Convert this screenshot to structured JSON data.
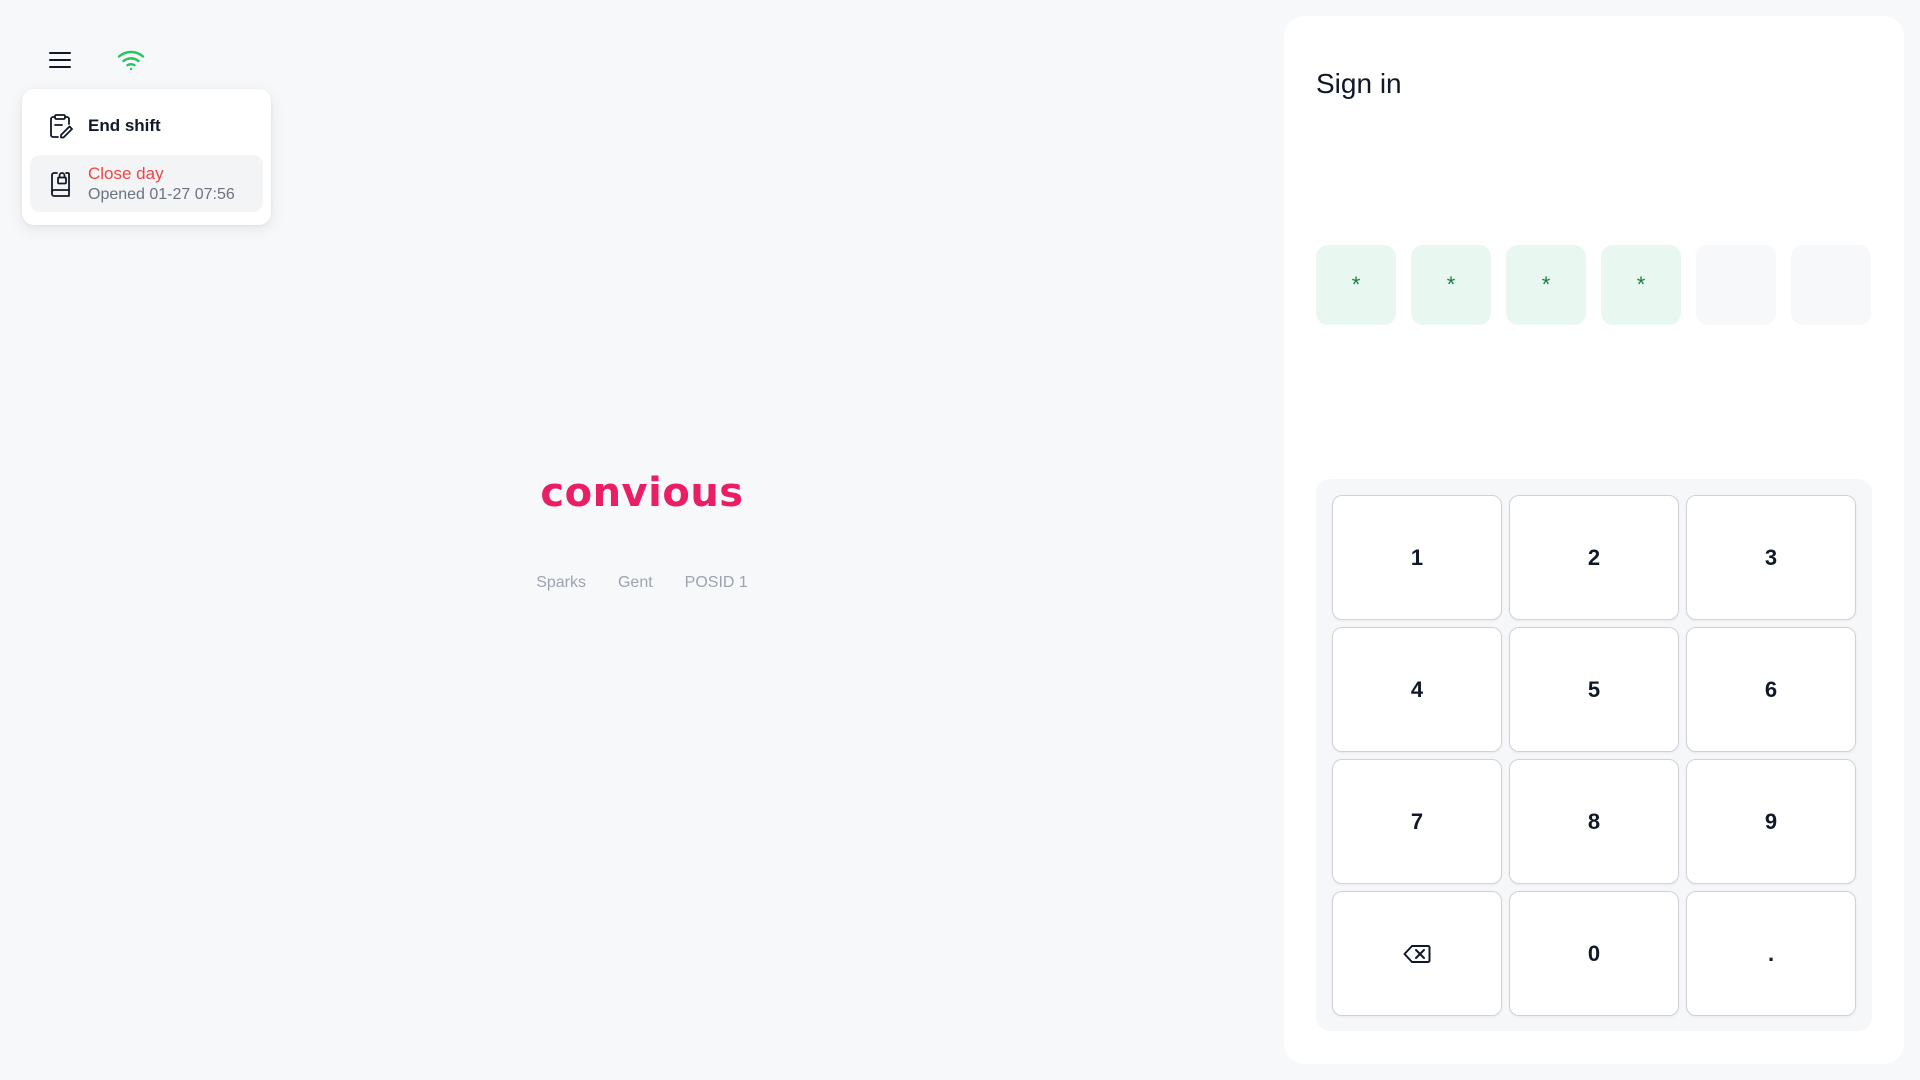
{
  "header": {
    "menu_icon": "hamburger-icon",
    "wifi_icon": "wifi-icon",
    "wifi_color": "#22c55e"
  },
  "menu": {
    "end_shift": {
      "label": "End shift",
      "icon": "clipboard-edit-icon"
    },
    "close_day": {
      "label": "Close day",
      "subtitle": "Opened 01-27 07:56",
      "icon": "lock-book-icon",
      "label_color": "#ef4444"
    }
  },
  "brand": {
    "name": "convious",
    "color": "#e91e63",
    "meta": [
      "Sparks",
      "Gent",
      "POSID 1"
    ]
  },
  "signin": {
    "title": "Sign in",
    "pin": [
      "*",
      "*",
      "*",
      "*",
      "",
      ""
    ],
    "keypad": [
      "1",
      "2",
      "3",
      "4",
      "5",
      "6",
      "7",
      "8",
      "9",
      "backspace",
      "0",
      "."
    ],
    "backspace_icon": "backspace-icon"
  }
}
